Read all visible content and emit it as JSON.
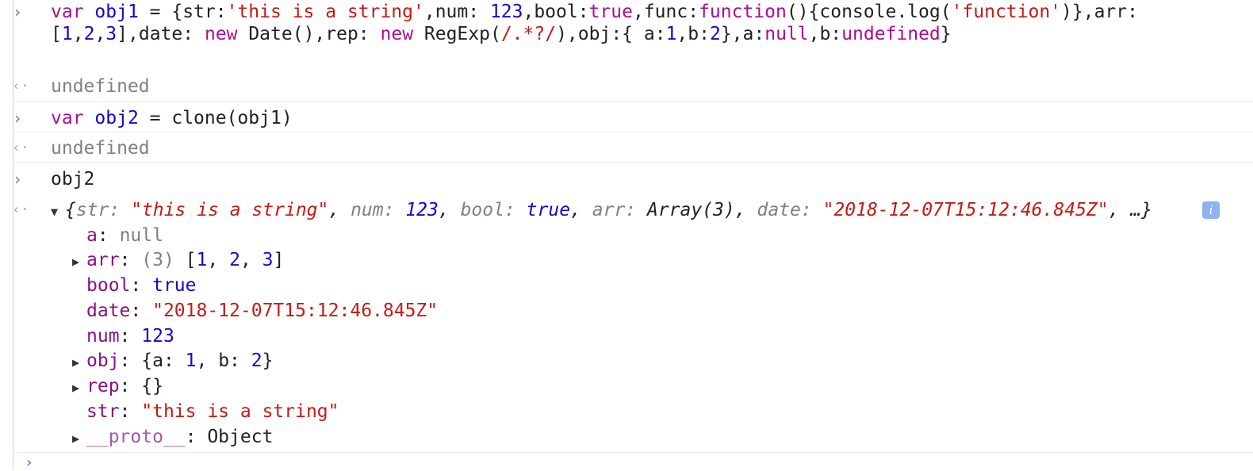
{
  "entries": [
    {
      "type": "input",
      "line1": {
        "kw_var": "var",
        "name": "obj1",
        "eq": " = ",
        "t1": "{str:",
        "s1": "'this is a string'",
        "t2": ",num: ",
        "n1": "123",
        "t3": ",bool:",
        "b1": "true",
        "t4": ",func:",
        "f1": "function",
        "t5": "(){console.log(",
        "s2": "'function'",
        "t6": ")},arr:"
      },
      "line2": {
        "t1": "[",
        "n1": "1",
        "c1": ",",
        "n2": "2",
        "c2": ",",
        "n3": "3",
        "t2": "],date: ",
        "kw_new1": "new",
        "t3": " Date(),rep: ",
        "kw_new2": "new",
        "t4": " RegExp(",
        "re": "/.*?/",
        "t5": "),obj:{ a:",
        "n4": "1",
        "t6": ",b:",
        "n5": "2",
        "t7": "},a:",
        "kw_null": "null",
        "t8": ",b:",
        "kw_undef": "undefined",
        "t9": "}"
      }
    },
    {
      "type": "result",
      "text": "undefined"
    },
    {
      "type": "input",
      "kw_var": "var",
      "name": "obj2",
      "eq": " = ",
      "rest": "clone(obj1)"
    },
    {
      "type": "result",
      "text": "undefined"
    },
    {
      "type": "input",
      "text": "obj2"
    }
  ],
  "object_preview": {
    "open": "{",
    "k_str": "str",
    "v_str": "\"this is a string\"",
    "k_num": "num",
    "v_num": "123",
    "k_bool": "bool",
    "v_bool": "true",
    "k_arr": "arr",
    "v_arr": "Array(3)",
    "k_date": "date",
    "v_date": "\"2018-12-07T15:12:46.845Z\"",
    "ellipsis": "…}",
    "info_icon": "i"
  },
  "properties": [
    {
      "key": "a",
      "value": "null",
      "expandable": false
    },
    {
      "key": "arr",
      "count": "(3)",
      "value": "[1, 2, 3]",
      "expandable": true
    },
    {
      "key": "bool",
      "value": "true",
      "expandable": false
    },
    {
      "key": "date",
      "value": "\"2018-12-07T15:12:46.845Z\"",
      "expandable": false
    },
    {
      "key": "num",
      "value": "123",
      "expandable": false
    },
    {
      "key": "obj",
      "value": "{a: 1, b: 2}",
      "expandable": true
    },
    {
      "key": "rep",
      "value": "{}",
      "expandable": true
    },
    {
      "key": "str",
      "value": "\"this is a string\"",
      "expandable": false
    },
    {
      "key": "__proto__",
      "value": "Object",
      "expandable": true
    }
  ],
  "colors": {
    "keyword": "#aa0d91",
    "string": "#c41a16",
    "number": "#1c00cf",
    "property": "#881280",
    "null": "#808080"
  }
}
